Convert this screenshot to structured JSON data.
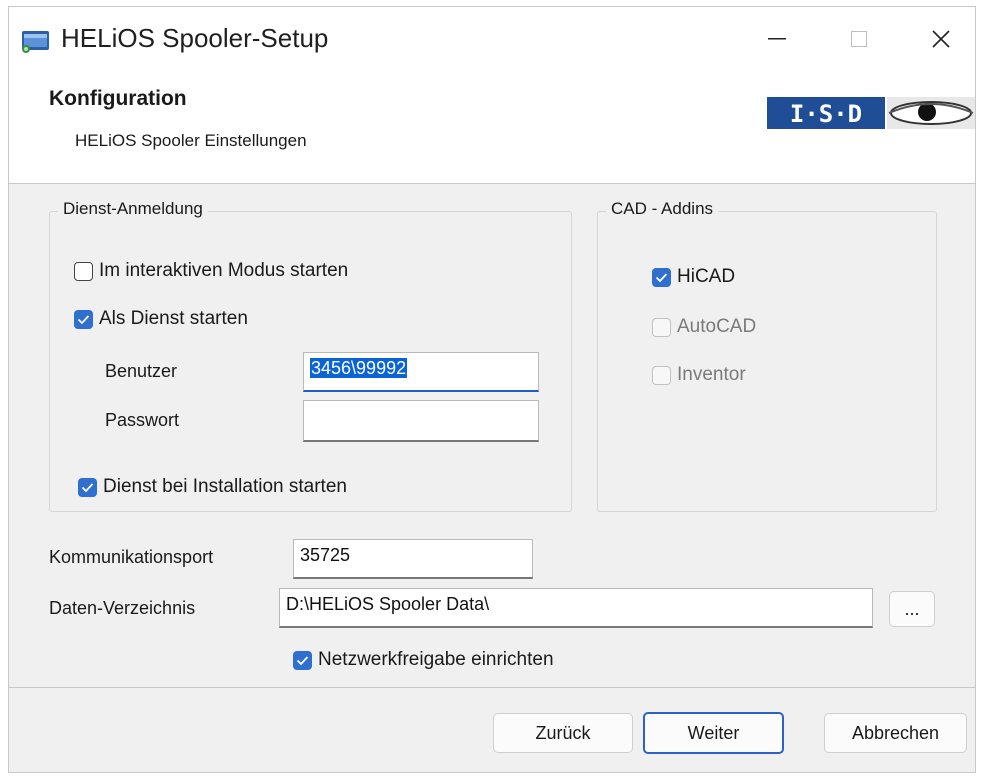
{
  "window": {
    "title": "HELiOS Spooler-Setup"
  },
  "header": {
    "title": "Konfiguration",
    "subtitle": "HELiOS Spooler Einstellungen",
    "logo_text": "I·S·D"
  },
  "dienst": {
    "legend": "Dienst-Anmeldung",
    "interactive_label": "Im interaktiven Modus starten",
    "interactive_checked": false,
    "service_label": "Als Dienst starten",
    "service_checked": true,
    "user_label": "Benutzer",
    "user_value": "3456\\99992",
    "password_label": "Passwort",
    "password_value": "",
    "start_on_install_label": "Dienst bei Installation starten",
    "start_on_install_checked": true
  },
  "cad": {
    "legend": "CAD - Addins",
    "items": [
      {
        "label": "HiCAD",
        "checked": true,
        "enabled": true
      },
      {
        "label": "AutoCAD",
        "checked": false,
        "enabled": false
      },
      {
        "label": "Inventor",
        "checked": false,
        "enabled": false
      }
    ]
  },
  "settings": {
    "port_label": "Kommunikationsport",
    "port_value": "35725",
    "dir_label": "Daten-Verzeichnis",
    "dir_value": "D:\\HELiOS Spooler Data\\",
    "browse_label": "...",
    "share_label": "Netzwerkfreigabe einrichten",
    "share_checked": true
  },
  "buttons": {
    "back": "Zurück",
    "next": "Weiter",
    "cancel": "Abbrechen"
  },
  "colors": {
    "accent": "#2f6fd0",
    "selection": "#0a64d6",
    "dialog_bg": "#f0f0f0",
    "logo_bg": "#1f4e96"
  }
}
